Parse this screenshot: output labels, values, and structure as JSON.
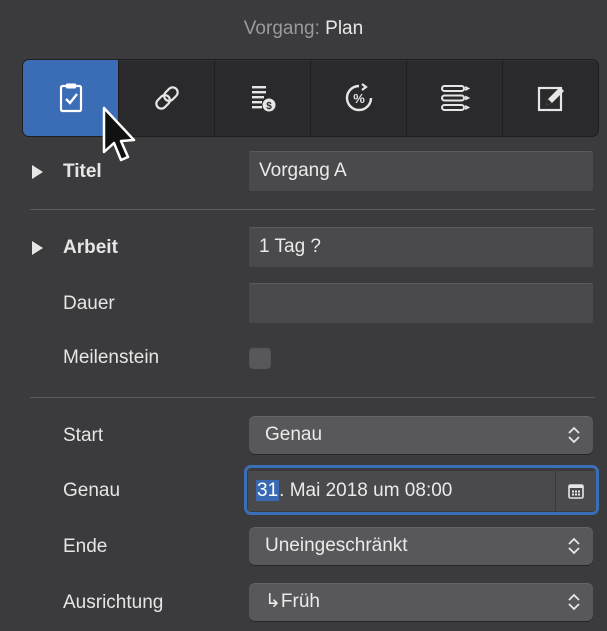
{
  "header": {
    "key": "Vorgang:",
    "value": "Plan"
  },
  "toolbar": {
    "tabs": [
      {
        "icon": "clipboard-check-icon",
        "active": true
      },
      {
        "icon": "link-icon",
        "active": false
      },
      {
        "icon": "cost-list-icon",
        "active": false
      },
      {
        "icon": "percent-progress-icon",
        "active": false
      },
      {
        "icon": "outline-list-icon",
        "active": false
      },
      {
        "icon": "edit-notes-icon",
        "active": false
      }
    ]
  },
  "fields": {
    "titel": {
      "label": "Titel",
      "value": "Vorgang A"
    },
    "arbeit": {
      "label": "Arbeit",
      "value": "1 Tag ?"
    },
    "dauer": {
      "label": "Dauer",
      "value": ""
    },
    "meilenstein": {
      "label": "Meilenstein",
      "checked": false
    },
    "start": {
      "label": "Start",
      "value": "Genau"
    },
    "genau": {
      "label": "Genau",
      "day": "31",
      "rest": ". Mai 2018 um 08:00"
    },
    "ende": {
      "label": "Ende",
      "value": "Uneingeschränkt"
    },
    "ausrichtung": {
      "label": "Ausrichtung",
      "value": "↳Früh"
    }
  },
  "colors": {
    "accent": "#3b6cb6",
    "background": "#3b3b3d"
  }
}
